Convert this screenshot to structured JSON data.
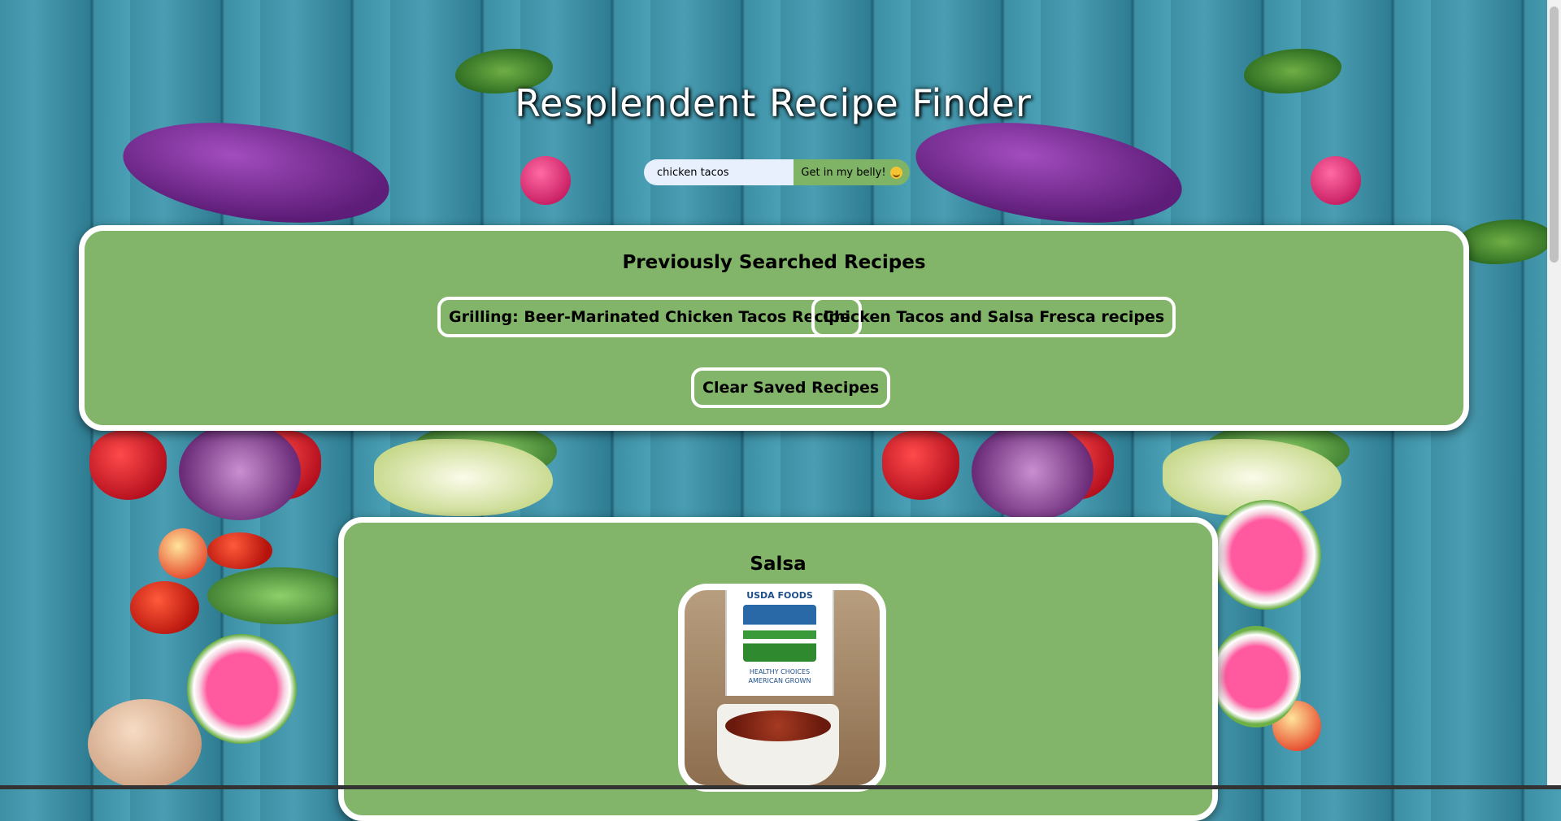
{
  "header": {
    "title": "Resplendent Recipe Finder"
  },
  "search": {
    "value": "chicken tacos",
    "button_label": "Get in my belly!",
    "button_icon": "smiling-face-emoji"
  },
  "history": {
    "heading": "Previously Searched Recipes",
    "items": [
      {
        "label": "Grilling: Beer-Marinated Chicken Tacos Recipe"
      },
      {
        "label": "Chicken Tacos and Salsa Fresca recipes"
      }
    ],
    "clear_label": "Clear Saved Recipes"
  },
  "recipe": {
    "title": "Salsa",
    "image": {
      "sign_title": "USDA FOODS",
      "sign_subtitle_1": "HEALTHY CHOICES",
      "sign_subtitle_2": "AMERICAN GROWN"
    }
  },
  "colors": {
    "panel": "#82b469",
    "panel_border": "#ffffff",
    "button": "#7fb366",
    "input_bg": "#e8f0fe"
  }
}
